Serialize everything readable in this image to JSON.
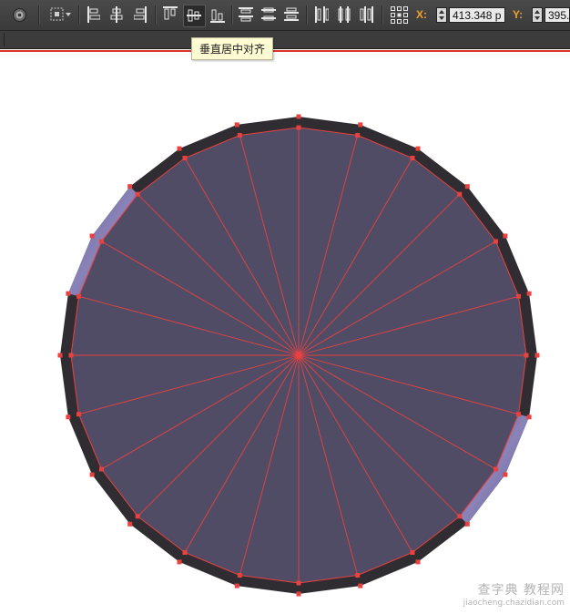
{
  "toolbar": {
    "x_label": "X:",
    "x_value": "413.348 p",
    "y_label": "Y:",
    "y_value": "395.",
    "tooltip": "垂直居中对齐"
  },
  "colors": {
    "toolbar_bg": "#424242",
    "selection": "#e8413f",
    "shape_fill": "#514c66",
    "stroke": "#2f2d31",
    "stroke_highlight": "#8f86c4",
    "coord_label": "#f0a030"
  },
  "icons": [
    "appearance-icon",
    "transform-reference-icon",
    "align-left-icon",
    "align-horizontal-center-icon",
    "align-right-icon",
    "align-top-icon",
    "align-vertical-center-icon",
    "align-bottom-icon",
    "distribute-top-icon",
    "distribute-vertical-center-icon",
    "distribute-bottom-icon",
    "distribute-left-icon",
    "distribute-horizontal-center-icon",
    "distribute-right-icon",
    "reference-point-icon"
  ],
  "canvas": {
    "shape": "polygon",
    "segments": 24
  },
  "watermark": {
    "line1": "查字典 教程网",
    "line2": "jiaocheng.chazidian.com"
  }
}
